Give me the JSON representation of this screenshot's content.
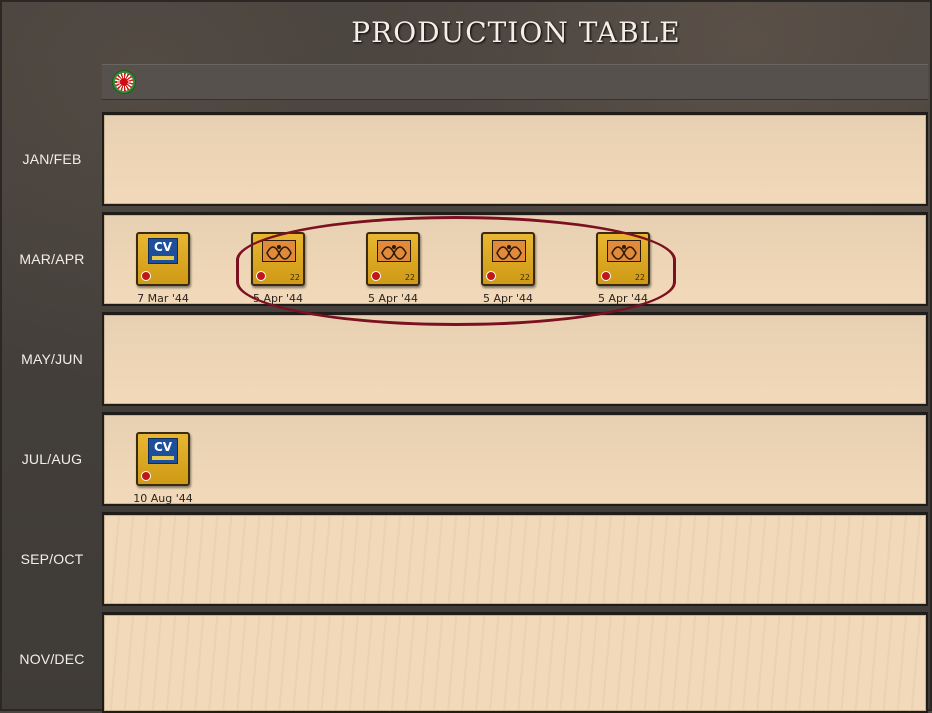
{
  "window": {
    "title": "PRODUCTION TABLE"
  },
  "faction": {
    "icon": "japan-flag-icon"
  },
  "rows": [
    {
      "label": "JAN/FEB"
    },
    {
      "label": "MAR/APR"
    },
    {
      "label": "MAY/JUN"
    },
    {
      "label": "JUL/AUG"
    },
    {
      "label": "SEP/OCT"
    },
    {
      "label": "NOV/DEC"
    }
  ],
  "units": [
    {
      "row": "MAR/APR",
      "type": "CV",
      "icon": "carrier-unit-icon",
      "date": "7 Mar '44"
    },
    {
      "row": "MAR/APR",
      "type": "tactical-air",
      "icon": "tactical-air-unit-icon",
      "badge": "22",
      "date": "5 Apr '44"
    },
    {
      "row": "MAR/APR",
      "type": "tactical-air",
      "icon": "tactical-air-unit-icon",
      "badge": "22",
      "date": "5 Apr '44"
    },
    {
      "row": "MAR/APR",
      "type": "tactical-air",
      "icon": "tactical-air-unit-icon",
      "badge": "22",
      "date": "5 Apr '44"
    },
    {
      "row": "MAR/APR",
      "type": "tactical-air",
      "icon": "tactical-air-unit-icon",
      "badge": "22",
      "date": "5 Apr '44"
    },
    {
      "row": "JUL/AUG",
      "type": "CV",
      "icon": "carrier-unit-icon",
      "date": "10 Aug '44"
    }
  ],
  "colors": {
    "highlight": "#7a1020",
    "counter": "#e0aa24",
    "panel": "#f1d9b9",
    "red_marker": "#c01818"
  }
}
